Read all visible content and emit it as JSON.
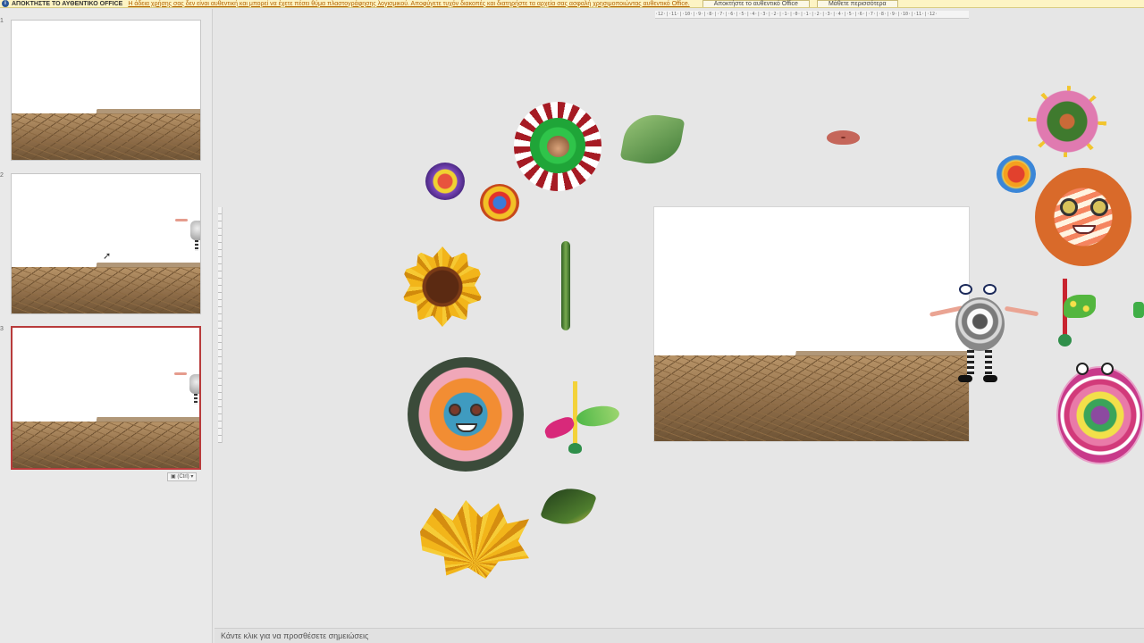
{
  "notice_bar": {
    "title": "ΑΠΟΚΤΗΣΤΕ ΤΟ ΑΥΘΕΝΤΙΚΟ OFFICE",
    "message": "Η άδεια χρήσης σας δεν είναι αυθεντική και μπορεί να έχετε πέσει θύμα πλαστογράφησης λογισμικού. Αποφύγετε τυχόν διακοπές και διατηρήστε τα αρχεία σας ασφαλή χρησιμοποιώντας αυθεντικό Office.",
    "get_genuine_button": "Αποκτήστε το αυθεντικό Office",
    "learn_more_button": "Μάθετε περισσότερα"
  },
  "thumbnails": [
    {
      "number": "1",
      "selected": false
    },
    {
      "number": "2",
      "selected": false
    },
    {
      "number": "3",
      "selected": true
    }
  ],
  "paste_options_label": "(Ctrl) ▾",
  "ruler_text": "·12·|·11·|·10·|·9·|·8·|·7·|·6·|·5·|·4·|·3·|·2·|·1·|·0·|·1·|·2·|·3·|·4·|·5·|·6·|·7·|·8·|·9·|·10·|·11·|·12·",
  "notes_placeholder": "Κάντε κλικ για να προσθέσετε σημειώσεις",
  "colors": {
    "notice_bg": "#fdf4c4",
    "selected_border": "#b83b3b",
    "canvas_bg": "#e6e6e6"
  }
}
